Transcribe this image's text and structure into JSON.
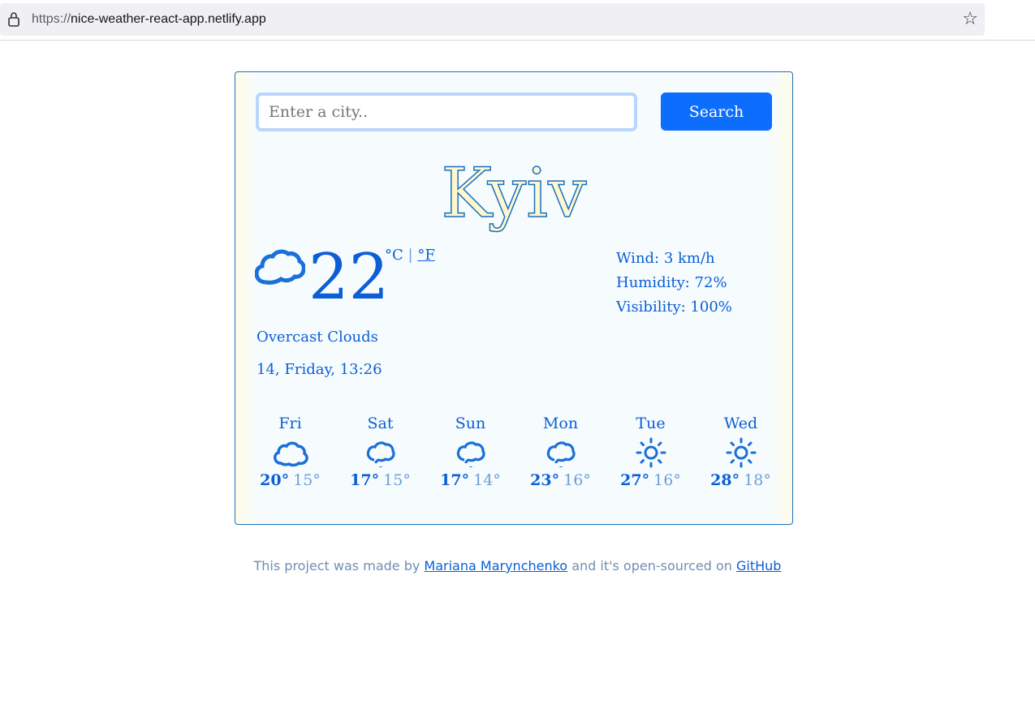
{
  "browser": {
    "url_protocol": "https://",
    "url_host": "nice-weather-react-app.netlify.app"
  },
  "search": {
    "placeholder": "Enter a city..",
    "button": "Search"
  },
  "current": {
    "city": "Kyiv",
    "icon": "cloud-icon",
    "temperature": "22",
    "unit_c": "°C",
    "separator": "|",
    "unit_f": "°F",
    "description": "Overcast Clouds",
    "datetime": "14, Friday, 13:26",
    "wind": "Wind: 3 km/h",
    "humidity": "Humidity: 72%",
    "visibility": "Visibility: 100%"
  },
  "forecast": [
    {
      "day": "Fri",
      "icon": "cloud-icon",
      "high": "20°",
      "low": "15°"
    },
    {
      "day": "Sat",
      "icon": "rain-cloud-icon",
      "high": "17°",
      "low": "15°"
    },
    {
      "day": "Sun",
      "icon": "rain-cloud-icon",
      "high": "17°",
      "low": "14°"
    },
    {
      "day": "Mon",
      "icon": "rain-cloud-icon",
      "high": "23°",
      "low": "16°"
    },
    {
      "day": "Tue",
      "icon": "sun-icon",
      "high": "27°",
      "low": "16°"
    },
    {
      "day": "Wed",
      "icon": "sun-icon",
      "high": "28°",
      "low": "18°"
    }
  ],
  "footer": {
    "prefix": "This project was made by",
    "author": "Mariana Marynchenko",
    "middle": "and it's open-sourced on",
    "repo": "GitHub"
  },
  "colors": {
    "accent": "#0d6efd",
    "text": "#0b5ed7",
    "city_fill": "#fff8cc"
  }
}
